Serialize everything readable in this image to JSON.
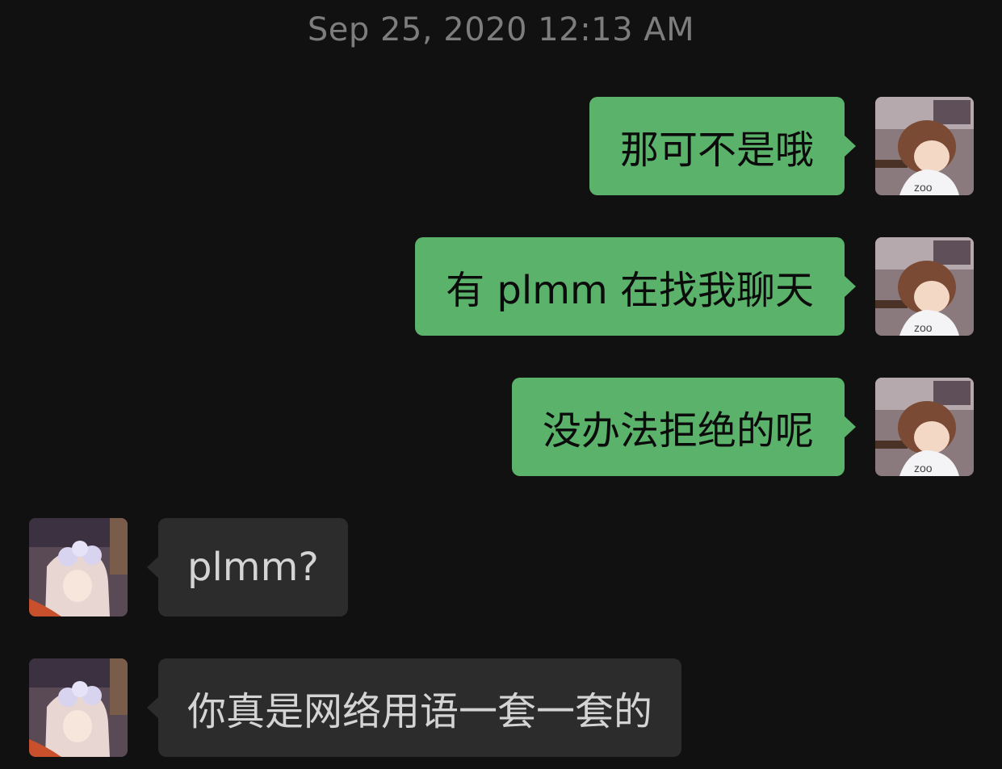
{
  "timestamp": "Sep 25, 2020 12:13 AM",
  "colors": {
    "background": "#111111",
    "outgoing_bubble": "#5bb36b",
    "incoming_bubble": "#2c2c2c",
    "timestamp_text": "#7d7d7d"
  },
  "messages": [
    {
      "side": "right",
      "text": "那可不是哦",
      "avatar": "boy-avatar"
    },
    {
      "side": "right",
      "text": "有 plmm 在找我聊天",
      "avatar": "boy-avatar"
    },
    {
      "side": "right",
      "text": "没办法拒绝的呢",
      "avatar": "boy-avatar"
    },
    {
      "side": "left",
      "text": "plmm?",
      "avatar": "girl-avatar"
    },
    {
      "side": "left",
      "text": "你真是网络用语一套一套的",
      "avatar": "girl-avatar"
    }
  ]
}
